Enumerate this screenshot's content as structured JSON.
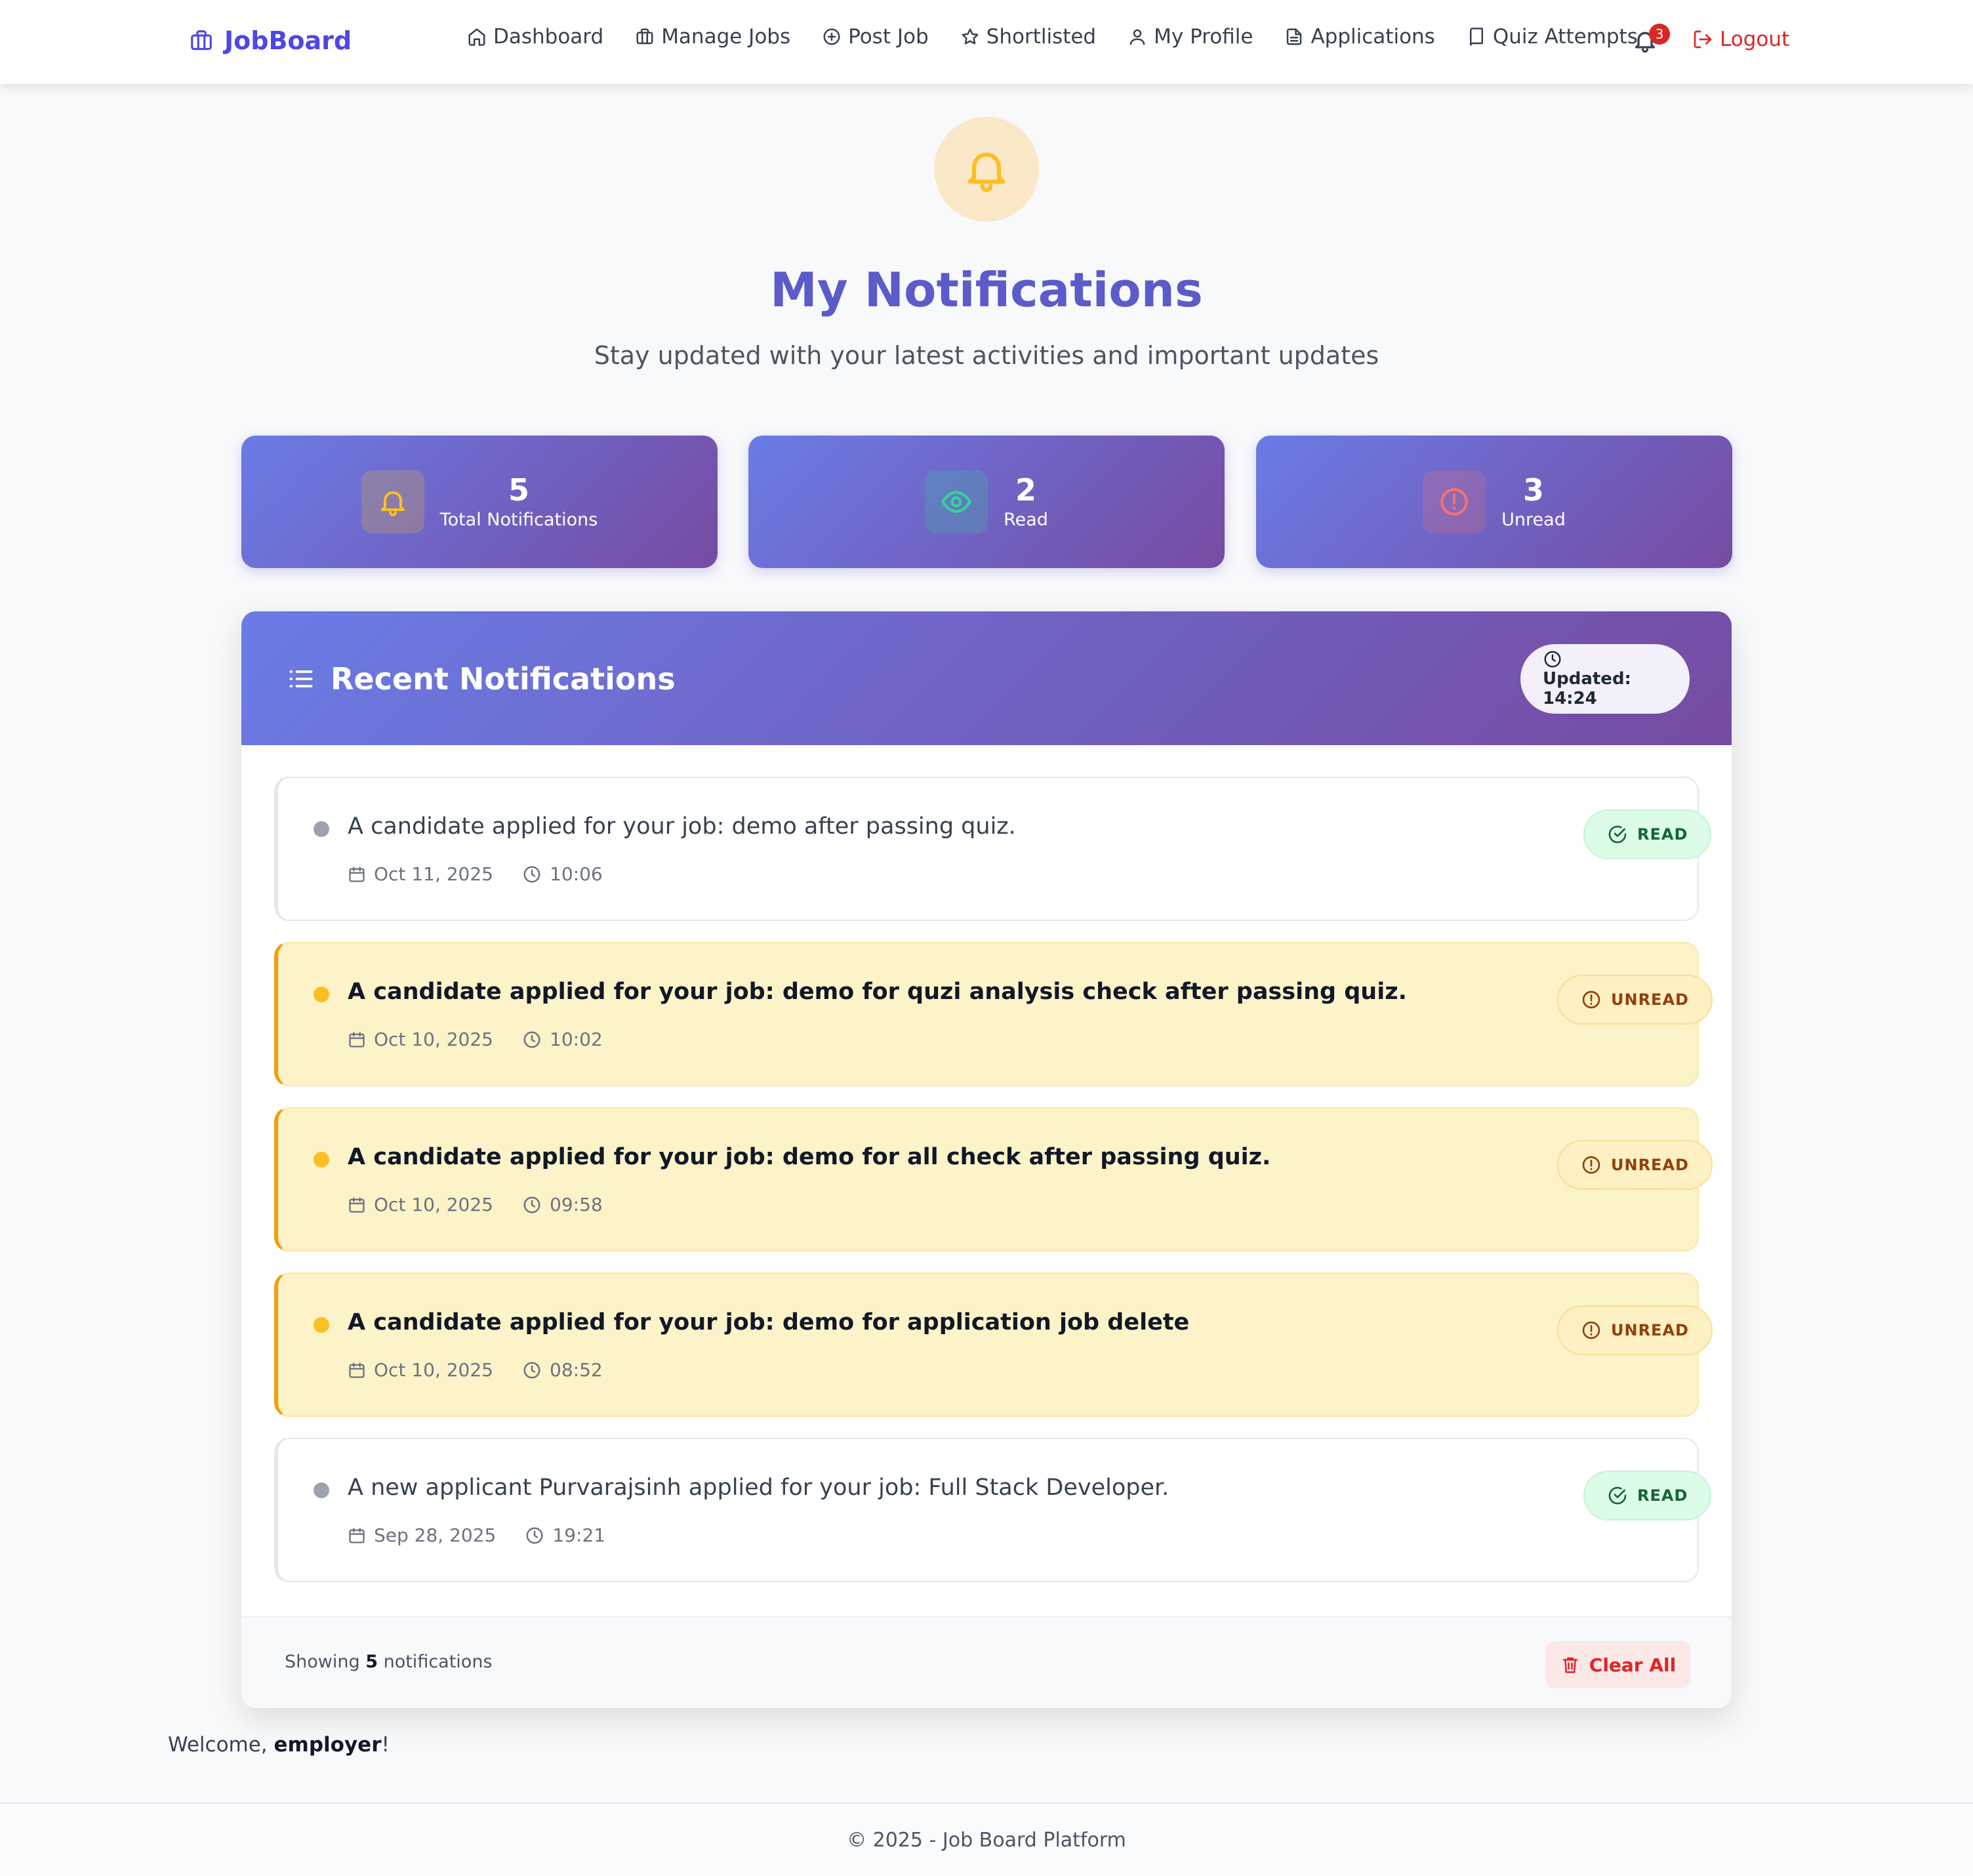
{
  "brand": {
    "name": "JobBoard"
  },
  "nav": {
    "items": [
      {
        "label": "Dashboard",
        "icon": "home-icon"
      },
      {
        "label": "Manage Jobs",
        "icon": "briefcase-icon"
      },
      {
        "label": "Post Job",
        "icon": "plus-circle-icon"
      },
      {
        "label": "Shortlisted",
        "icon": "star-icon"
      },
      {
        "label": "My Profile",
        "icon": "user-icon"
      },
      {
        "label": "Applications",
        "icon": "file-text-icon"
      },
      {
        "label": "Quiz Attempts",
        "icon": "book-icon"
      }
    ],
    "notification_count": "3",
    "logout_label": "Logout"
  },
  "hero": {
    "title": "My Notifications",
    "subtitle": "Stay updated with your latest activities and important updates"
  },
  "stats": [
    {
      "value": "5",
      "label": "Total Notifications",
      "icon": "bell-icon",
      "color": "#fbbf24"
    },
    {
      "value": "2",
      "label": "Read",
      "icon": "eye-icon",
      "color": "#34d399"
    },
    {
      "value": "3",
      "label": "Unread",
      "icon": "alert-circle-icon",
      "color": "#f87171"
    }
  ],
  "panel": {
    "title": "Recent Notifications",
    "updated_label": "Updated: 14:24",
    "notifications": [
      {
        "message": "A candidate applied for your job: demo after passing quiz.",
        "date": "Oct 11, 2025",
        "time": "10:06",
        "status": "READ",
        "read": true
      },
      {
        "message": "A candidate applied for your job: demo for quzi analysis check after passing quiz.",
        "date": "Oct 10, 2025",
        "time": "10:02",
        "status": "UNREAD",
        "read": false
      },
      {
        "message": "A candidate applied for your job: demo for all check after passing quiz.",
        "date": "Oct 10, 2025",
        "time": "09:58",
        "status": "UNREAD",
        "read": false
      },
      {
        "message": "A candidate applied for your job: demo for application job delete",
        "date": "Oct 10, 2025",
        "time": "08:52",
        "status": "UNREAD",
        "read": false
      },
      {
        "message": "A new applicant Purvarajsinh applied for your job: Full Stack Developer.",
        "date": "Sep 28, 2025",
        "time": "19:21",
        "status": "READ",
        "read": true
      }
    ],
    "footer": {
      "showing_prefix": "Showing",
      "showing_count": "5",
      "showing_suffix": "notifications",
      "clear_label": "Clear All"
    }
  },
  "welcome": {
    "prefix": "Welcome,",
    "user": "employer",
    "suffix": "!"
  },
  "footer": {
    "text": "© 2025 - Job Board Platform"
  },
  "colors": {
    "brand": "#4f46e5",
    "title": "#5b5bc9",
    "danger": "#dc2626",
    "unread_accent": "#f59e0b"
  }
}
